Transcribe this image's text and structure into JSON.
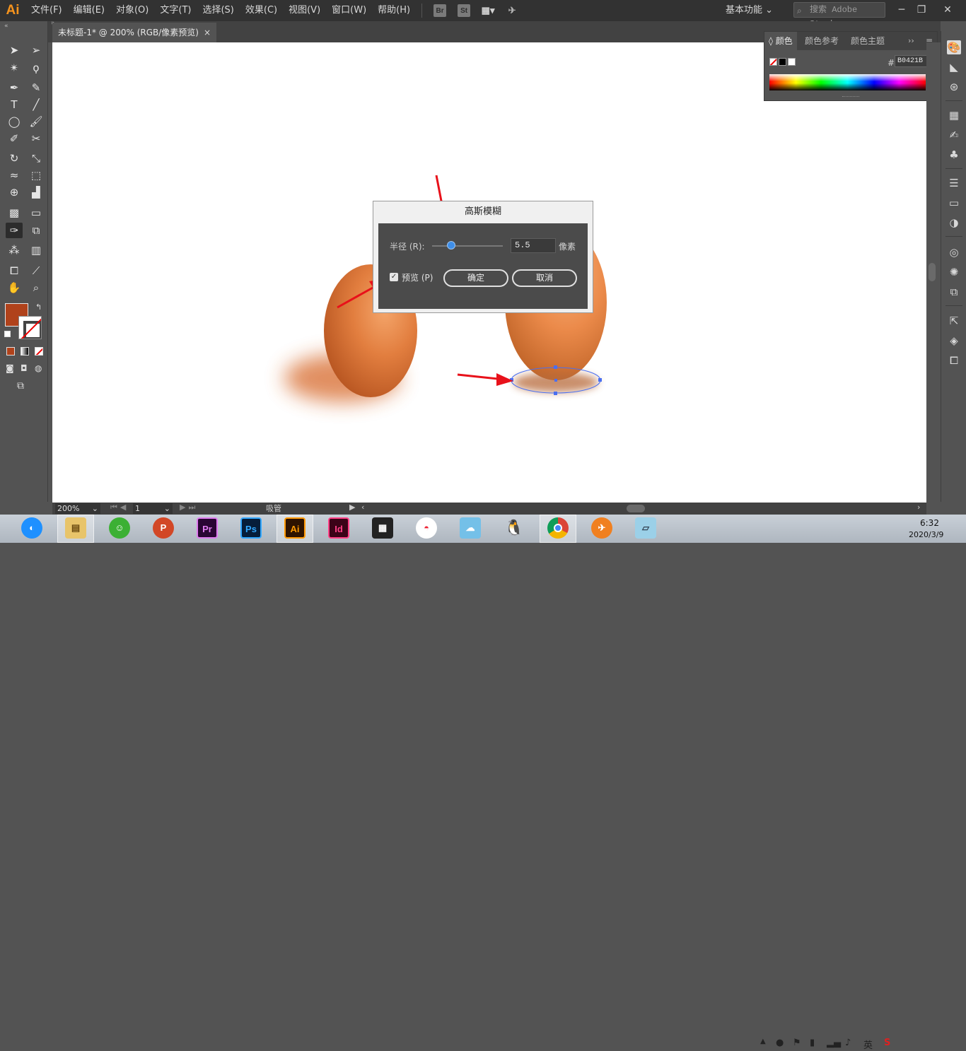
{
  "app": {
    "logo": "Ai",
    "accent": "#f7941d"
  },
  "menu": [
    "文件(F)",
    "编辑(E)",
    "对象(O)",
    "文字(T)",
    "选择(S)",
    "效果(C)",
    "视图(V)",
    "窗口(W)",
    "帮助(H)"
  ],
  "menubar_icons": {
    "bridge": "Br",
    "stock": "St"
  },
  "workspace": {
    "label": "基本功能"
  },
  "search": {
    "placeholder": "搜索 Adobe Stock"
  },
  "document": {
    "tab_title": "未标题-1* @ 200% (RGB/像素预览)",
    "close": "×"
  },
  "color_panel": {
    "tabs": [
      "颜色",
      "颜色参考",
      "颜色主题"
    ],
    "hex_symbol": "#",
    "hex": "B0421B",
    "fill_color": "#b0421b"
  },
  "dialog": {
    "title": "高斯模糊",
    "radius_label": "半径 (R):",
    "radius_value": "5.5",
    "radius_unit": "像素",
    "preview_label": "预览 (P)",
    "preview_checked": true,
    "ok_label": "确定",
    "cancel_label": "取消"
  },
  "status": {
    "zoom": "200%",
    "artboard": "1",
    "tool": "吸管"
  },
  "taskbar": {
    "apps": [
      "Pr",
      "Ps",
      "Ai",
      "Id"
    ],
    "tray": {
      "ime": "英"
    },
    "time": "6:32",
    "date": "2020/3/9"
  }
}
